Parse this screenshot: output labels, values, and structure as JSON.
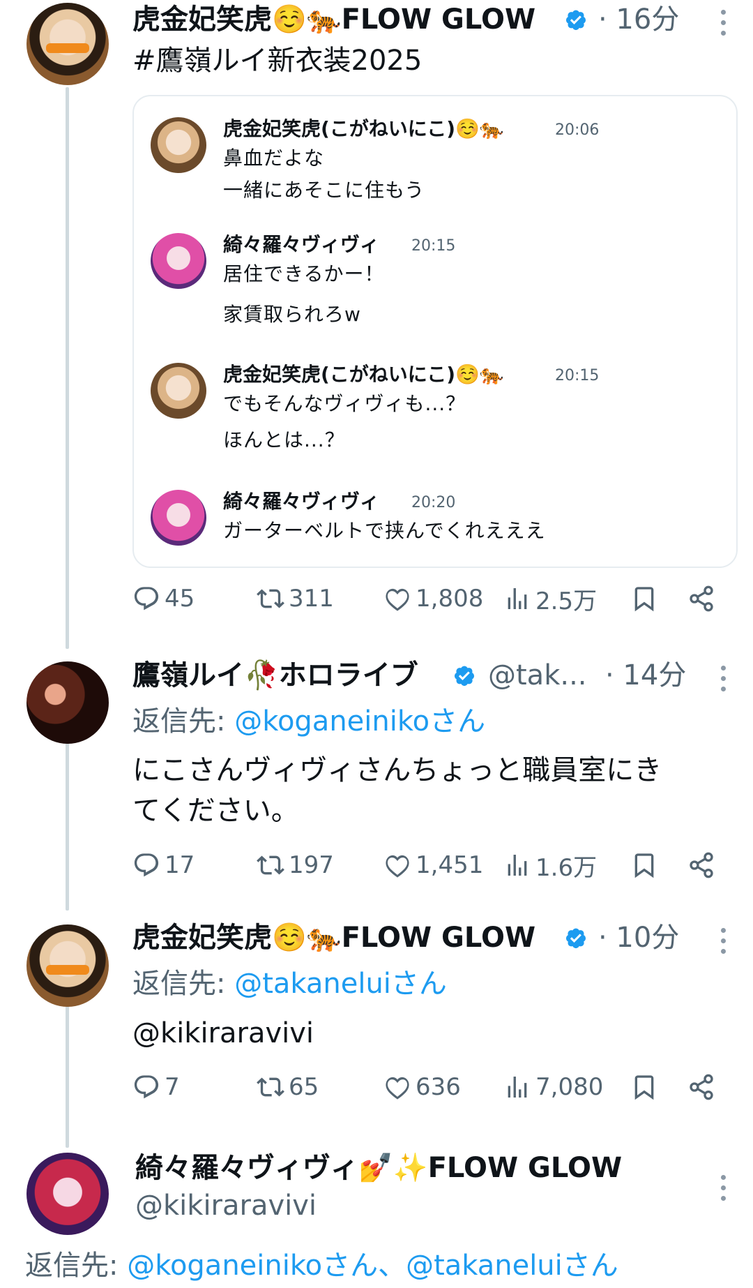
{
  "tweet1": {
    "author": "虎金妃笑虎☺️🐅FLOW GLOW",
    "time": "· 16分",
    "hashtag": "#鷹嶺ルイ新衣装2025",
    "quote": {
      "messages": [
        {
          "name": "虎金妃笑虎(こがねいにこ)☺️🐅",
          "time": "20:06",
          "lines": [
            "鼻血だよな",
            "一緒にあそこに住もう"
          ]
        },
        {
          "name": "綺々羅々ヴィヴィ",
          "time": "20:15",
          "lines": [
            "居住できるかー！",
            "家賃取られろw"
          ]
        },
        {
          "name": "虎金妃笑虎(こがねいにこ)☺️🐅",
          "time": "20:15",
          "lines": [
            "でもそんなヴィヴィも...？",
            "ほんとは...？"
          ]
        },
        {
          "name": "綺々羅々ヴィヴィ",
          "time": "20:20",
          "lines": [
            "ガーターベルトで挟んでくれえええ"
          ]
        }
      ]
    },
    "stats": {
      "replies": "45",
      "retweets": "311",
      "likes": "1,808",
      "views": "2.5万"
    }
  },
  "tweet2": {
    "author": "鷹嶺ルイ🥀ホロライブ",
    "handle": "@tak...",
    "time": "· 14分",
    "reply_prefix": "返信先:",
    "reply_to": "@koganeinikoさん",
    "text_line1": "にこさんヴィヴィさんちょっと職員室にき",
    "text_line2": "てください。",
    "stats": {
      "replies": "17",
      "retweets": "197",
      "likes": "1,451",
      "views": "1.6万"
    }
  },
  "tweet3": {
    "author": "虎金妃笑虎☺️🐅FLOW GLOW",
    "time": "· 10分",
    "reply_prefix": "返信先:",
    "reply_to": "@takaneluiさん",
    "mention": "@kikiraravivi",
    "stats": {
      "replies": "7",
      "retweets": "65",
      "likes": "636",
      "views": "7,080"
    }
  },
  "tweet4": {
    "author": "綺々羅々ヴィヴィ💅✨FLOW GLOW",
    "handle": "@kikiraravivi",
    "reply_prefix": "返信先:",
    "reply_to": "@koganeinikoさん、@takaneluiさん"
  },
  "colors": {
    "accent": "#1d9bf0",
    "secondary_text": "#536471",
    "border": "#e6ecf0"
  },
  "icons": [
    "verified-badge-icon",
    "more-options-icon",
    "reply-icon",
    "retweet-icon",
    "like-icon",
    "views-icon",
    "bookmark-icon",
    "share-icon"
  ]
}
